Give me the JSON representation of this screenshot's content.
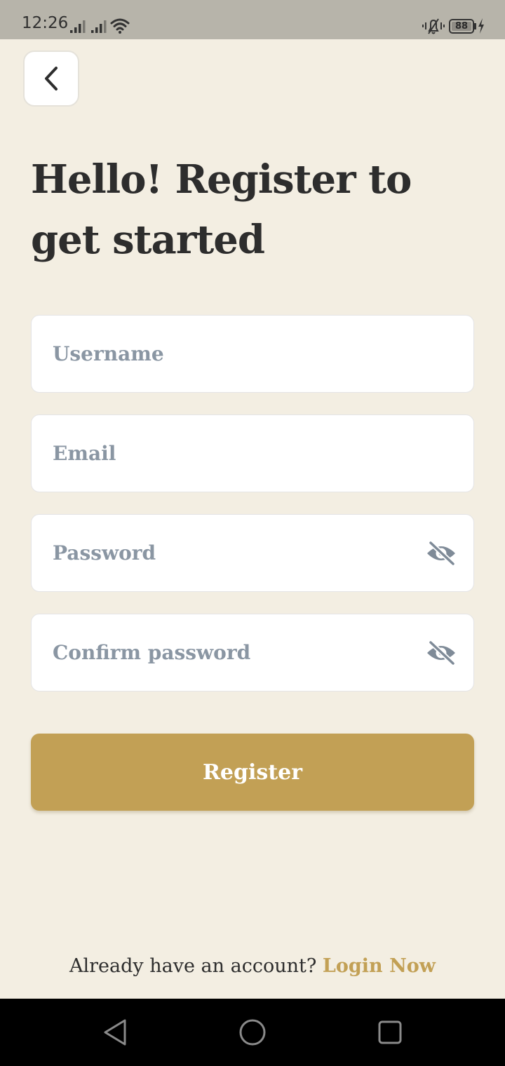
{
  "status_bar": {
    "time": "12:26",
    "battery_level": "88"
  },
  "header": {
    "title": "Hello! Register to get started"
  },
  "form": {
    "username_placeholder": "Username",
    "email_placeholder": "Email",
    "password_placeholder": "Password",
    "confirm_password_placeholder": "Confirm password",
    "register_label": "Register"
  },
  "footer": {
    "prompt_text": "Already have an account?",
    "login_label": "Login Now"
  },
  "icons": {
    "back": "chevron-left-icon",
    "password_toggle": "eye-off-icon",
    "nav": [
      "triangle-back-icon",
      "circle-home-icon",
      "square-recents-icon"
    ]
  },
  "colors": {
    "background": "#f3eee2",
    "accent": "#c2a055",
    "placeholder": "#8a96a3",
    "text": "#2d2d2d"
  }
}
